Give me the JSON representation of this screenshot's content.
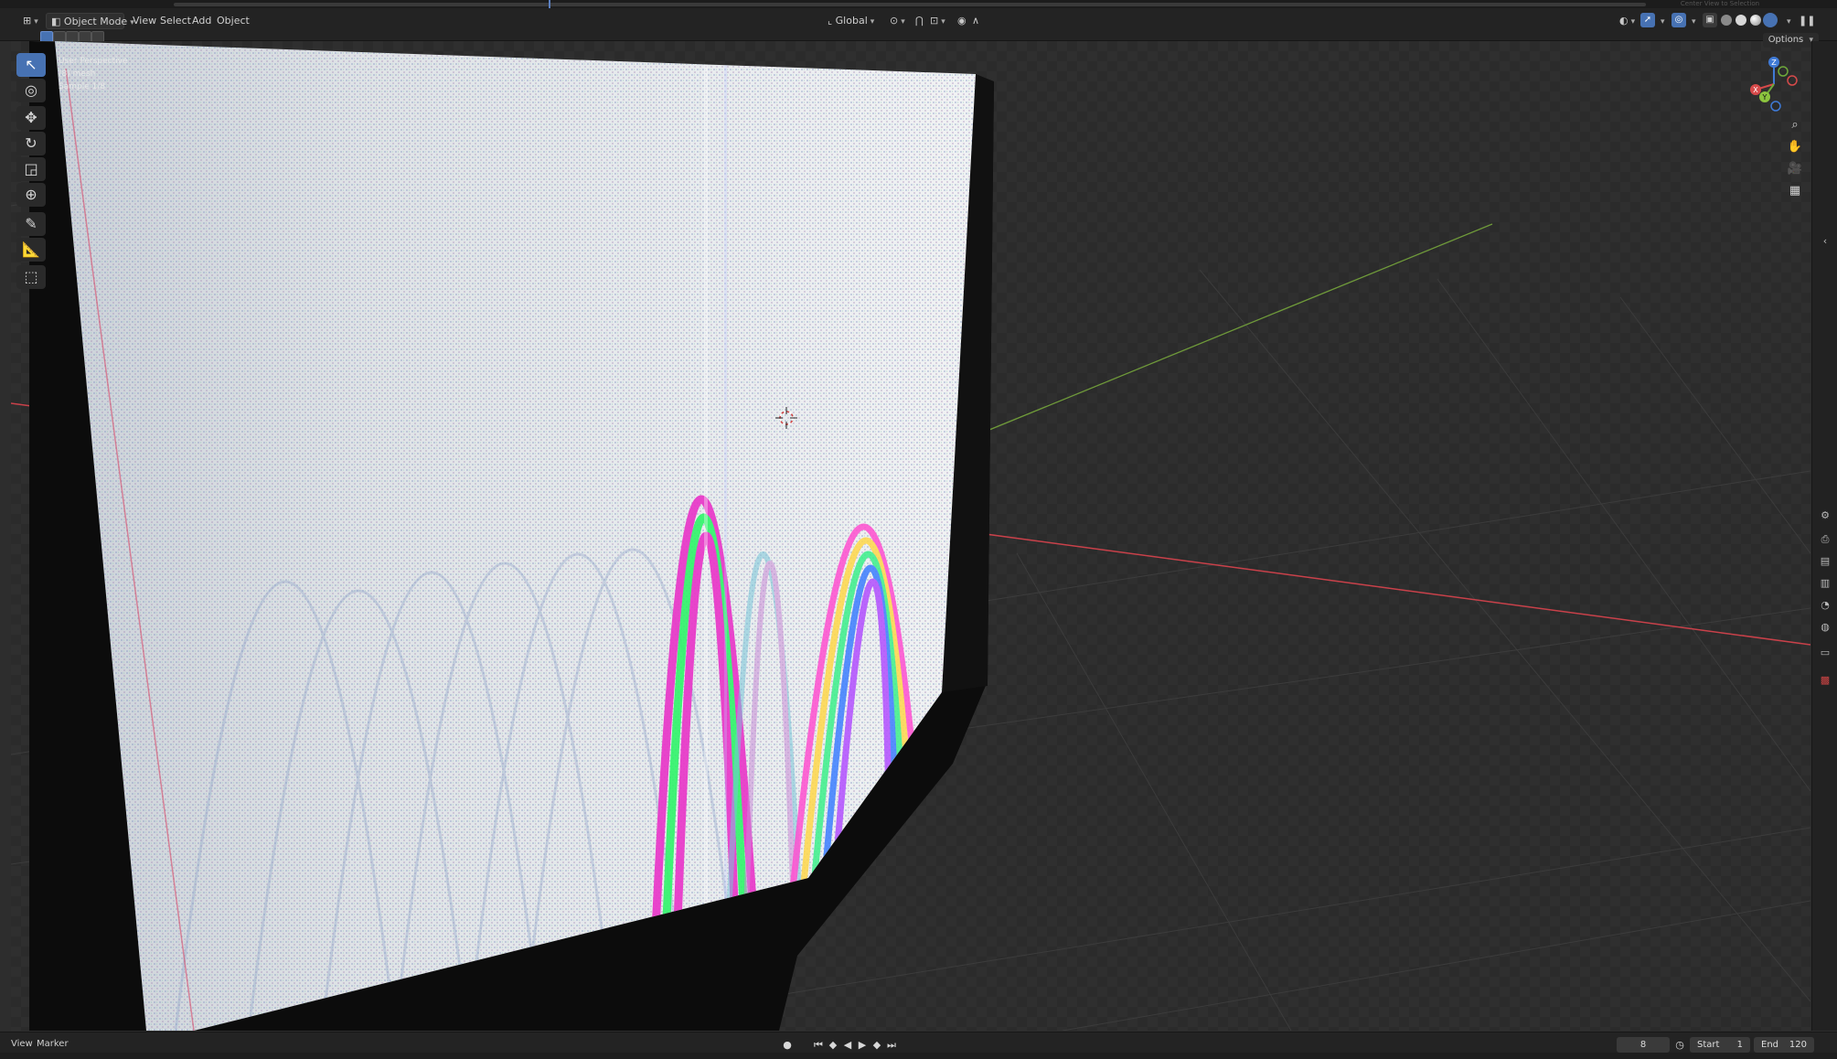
{
  "header": {
    "editor_type_icon": "3d-viewport-icon",
    "mode": {
      "label": "Object Mode",
      "icon": "cube-mode-icon"
    },
    "menus": [
      "View",
      "Select",
      "Add",
      "Object"
    ],
    "transform_orientation": {
      "label": "Global",
      "icon": "orientation-icon"
    },
    "pivot_icon": "pivot-icon",
    "snap_icon": "snap-magnet-icon",
    "snap_target_icon": "snap-target-icon",
    "proportional_icon": "proportional-edit-icon",
    "falloff_icon": "falloff-curve-icon",
    "right_icons": [
      "visibility-eye-icon",
      "gizmo-arrow-icon",
      "overlay-circles-icon",
      "xray-icon"
    ],
    "shading_modes": [
      "wireframe",
      "solid",
      "material-preview",
      "rendered"
    ],
    "active_shading": "rendered",
    "options_label": "Options",
    "dim_hint": "Center View to Selection"
  },
  "viewport": {
    "info": {
      "view_name": "User Perspective",
      "collection_object": "(8) mesh",
      "sample": "Sample 1/8"
    },
    "colors": {
      "x_axis": "#c9414a",
      "y_axis": "#6f9a3a",
      "background": "#2b2b2b",
      "grid": "#3a3a3a"
    }
  },
  "toolbar": {
    "tools": [
      {
        "name": "select-box",
        "icon": "↖",
        "active": true
      },
      {
        "name": "cursor",
        "icon": "◎",
        "active": false
      },
      {
        "name": "move",
        "icon": "✥",
        "active": false
      },
      {
        "name": "rotate",
        "icon": "↻",
        "active": false
      },
      {
        "name": "scale",
        "icon": "◲",
        "active": false
      },
      {
        "name": "transform",
        "icon": "⊕",
        "active": false
      },
      {
        "name": "annotate",
        "icon": "✎",
        "active": false
      },
      {
        "name": "measure",
        "icon": "📐",
        "active": false
      },
      {
        "name": "add-cube",
        "icon": "⬚",
        "active": false
      }
    ]
  },
  "gizmo": {
    "z_label": "Z",
    "y_label": "Y",
    "x_label": "X"
  },
  "navigation": {
    "zoom_icon": "⌕",
    "pan_icon": "✋",
    "camera_icon": "🎥",
    "ortho_icon": "▦"
  },
  "properties_tabs": [
    "tool",
    "render",
    "output",
    "view-layer",
    "scene",
    "world",
    "collection",
    "texture"
  ],
  "timeline": {
    "menus": [
      "View",
      "Marker"
    ],
    "current_frame": "8",
    "start_label": "Start",
    "start_value": "1",
    "end_label": "End",
    "end_value": "120"
  }
}
